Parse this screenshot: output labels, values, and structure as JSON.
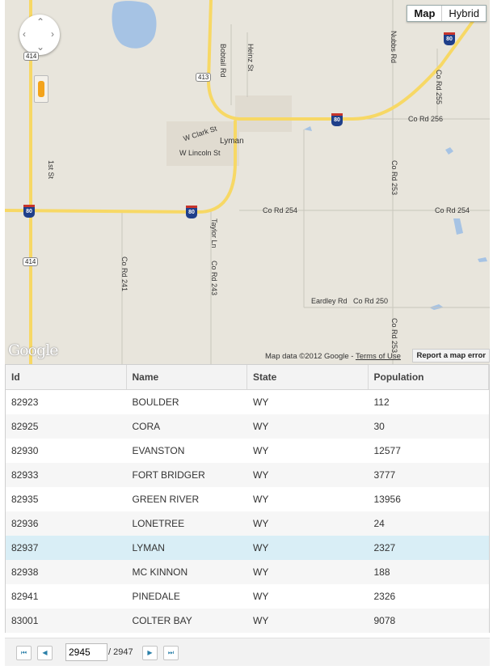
{
  "map": {
    "type_buttons": [
      {
        "label": "Map",
        "active": true
      },
      {
        "label": "Hybrid",
        "active": false
      }
    ],
    "place_labels": [
      {
        "text": "Lyman"
      },
      {
        "text": "W Clark St"
      },
      {
        "text": "W Lincoln St"
      },
      {
        "text": "Co Rd 256"
      },
      {
        "text": "Co Rd 254"
      },
      {
        "text": "Co Rd 254"
      },
      {
        "text": "Eardley Rd"
      },
      {
        "text": "Co Rd 250"
      }
    ],
    "vertical_labels": [
      {
        "text": "Bobtail Rd"
      },
      {
        "text": "Heinz St"
      },
      {
        "text": "Nubbs Rd"
      },
      {
        "text": "Co Rd 255"
      },
      {
        "text": "1st St"
      },
      {
        "text": "Co Rd 253"
      },
      {
        "text": "Taylor Ln"
      },
      {
        "text": "Co Rd 243"
      },
      {
        "text": "Co Rd 241"
      },
      {
        "text": "Co Rd 253"
      }
    ],
    "route_shields": [
      "414",
      "413",
      "414"
    ],
    "interstate_shields": [
      "80",
      "80",
      "80",
      "80"
    ],
    "logo": "Google",
    "attribution": "Map data ©2012 Google - ",
    "terms_link": "Terms of Use",
    "report_error": "Report a map error"
  },
  "grid": {
    "columns": [
      "Id",
      "Name",
      "State",
      "Population"
    ],
    "rows": [
      [
        "82923",
        "BOULDER",
        "WY",
        "112"
      ],
      [
        "82925",
        "CORA",
        "WY",
        "30"
      ],
      [
        "82930",
        "EVANSTON",
        "WY",
        "12577"
      ],
      [
        "82933",
        "FORT BRIDGER",
        "WY",
        "3777"
      ],
      [
        "82935",
        "GREEN RIVER",
        "WY",
        "13956"
      ],
      [
        "82936",
        "LONETREE",
        "WY",
        "24"
      ],
      [
        "82937",
        "LYMAN",
        "WY",
        "2327"
      ],
      [
        "82938",
        "MC KINNON",
        "WY",
        "188"
      ],
      [
        "82941",
        "PINEDALE",
        "WY",
        "2326"
      ],
      [
        "83001",
        "COLTER BAY",
        "WY",
        "9078"
      ]
    ],
    "selected_row_index": 6
  },
  "pager": {
    "current_page": "2945",
    "total_label": "/ 2947",
    "icons": [
      "first-page-icon",
      "prev-page-icon",
      "next-page-icon",
      "last-page-icon"
    ]
  },
  "colors": {
    "map_bg": "#e8e5dc",
    "road_yellow": "#f7d865",
    "water": "#a6c3e4",
    "selected_row": "#d9eef6"
  }
}
